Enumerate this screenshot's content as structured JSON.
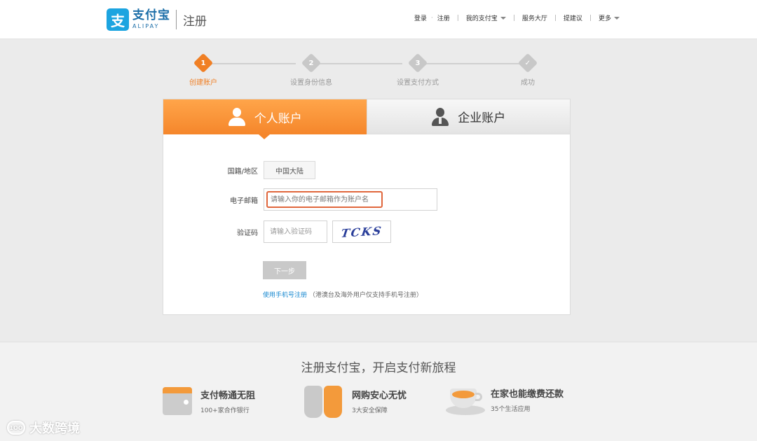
{
  "header": {
    "logo_mark": "支",
    "logo_cn": "支付宝",
    "logo_en": "ALIPAY",
    "page_title": "注册",
    "nav": {
      "login": "登录",
      "register": "注册",
      "my_alipay": "我的支付宝",
      "service_hall": "服务大厅",
      "suggest": "提建议",
      "more": "更多"
    }
  },
  "steps": [
    {
      "num": "1",
      "label": "创建账户",
      "active": true
    },
    {
      "num": "2",
      "label": "设置身份信息",
      "active": false
    },
    {
      "num": "3",
      "label": "设置支付方式",
      "active": false
    },
    {
      "num": "✓",
      "label": "成功",
      "active": false
    }
  ],
  "tabs": {
    "personal": "个人账户",
    "company": "企业账户"
  },
  "form": {
    "region_label": "国籍/地区",
    "region_value": "中国大陆",
    "email_label": "电子邮箱",
    "email_placeholder": "请输入你的电子邮箱作为账户名",
    "code_label": "验证码",
    "code_placeholder": "请输入验证码",
    "captcha_text": "TCKS",
    "next_button": "下一步",
    "phone_link": "使用手机号注册",
    "phone_note": "（港澳台及海外用户仅支持手机号注册）"
  },
  "footer": {
    "slogan": "注册支付宝，开启支付新旅程",
    "features": [
      {
        "title": "支付畅通无阻",
        "sub": "100+家合作银行",
        "icon": "wallet-icon"
      },
      {
        "title": "网购安心无忧",
        "sub": "3大安全保障",
        "icon": "hands-icon"
      },
      {
        "title": "在家也能缴费还款",
        "sub": "35个生活应用",
        "icon": "teacup-icon"
      }
    ]
  },
  "watermark": {
    "text": "大数跨境",
    "icon_text": "1OO"
  },
  "colors": {
    "accent": "#f07f24",
    "brand": "#1ca4e0",
    "link": "#1a8ad1"
  }
}
